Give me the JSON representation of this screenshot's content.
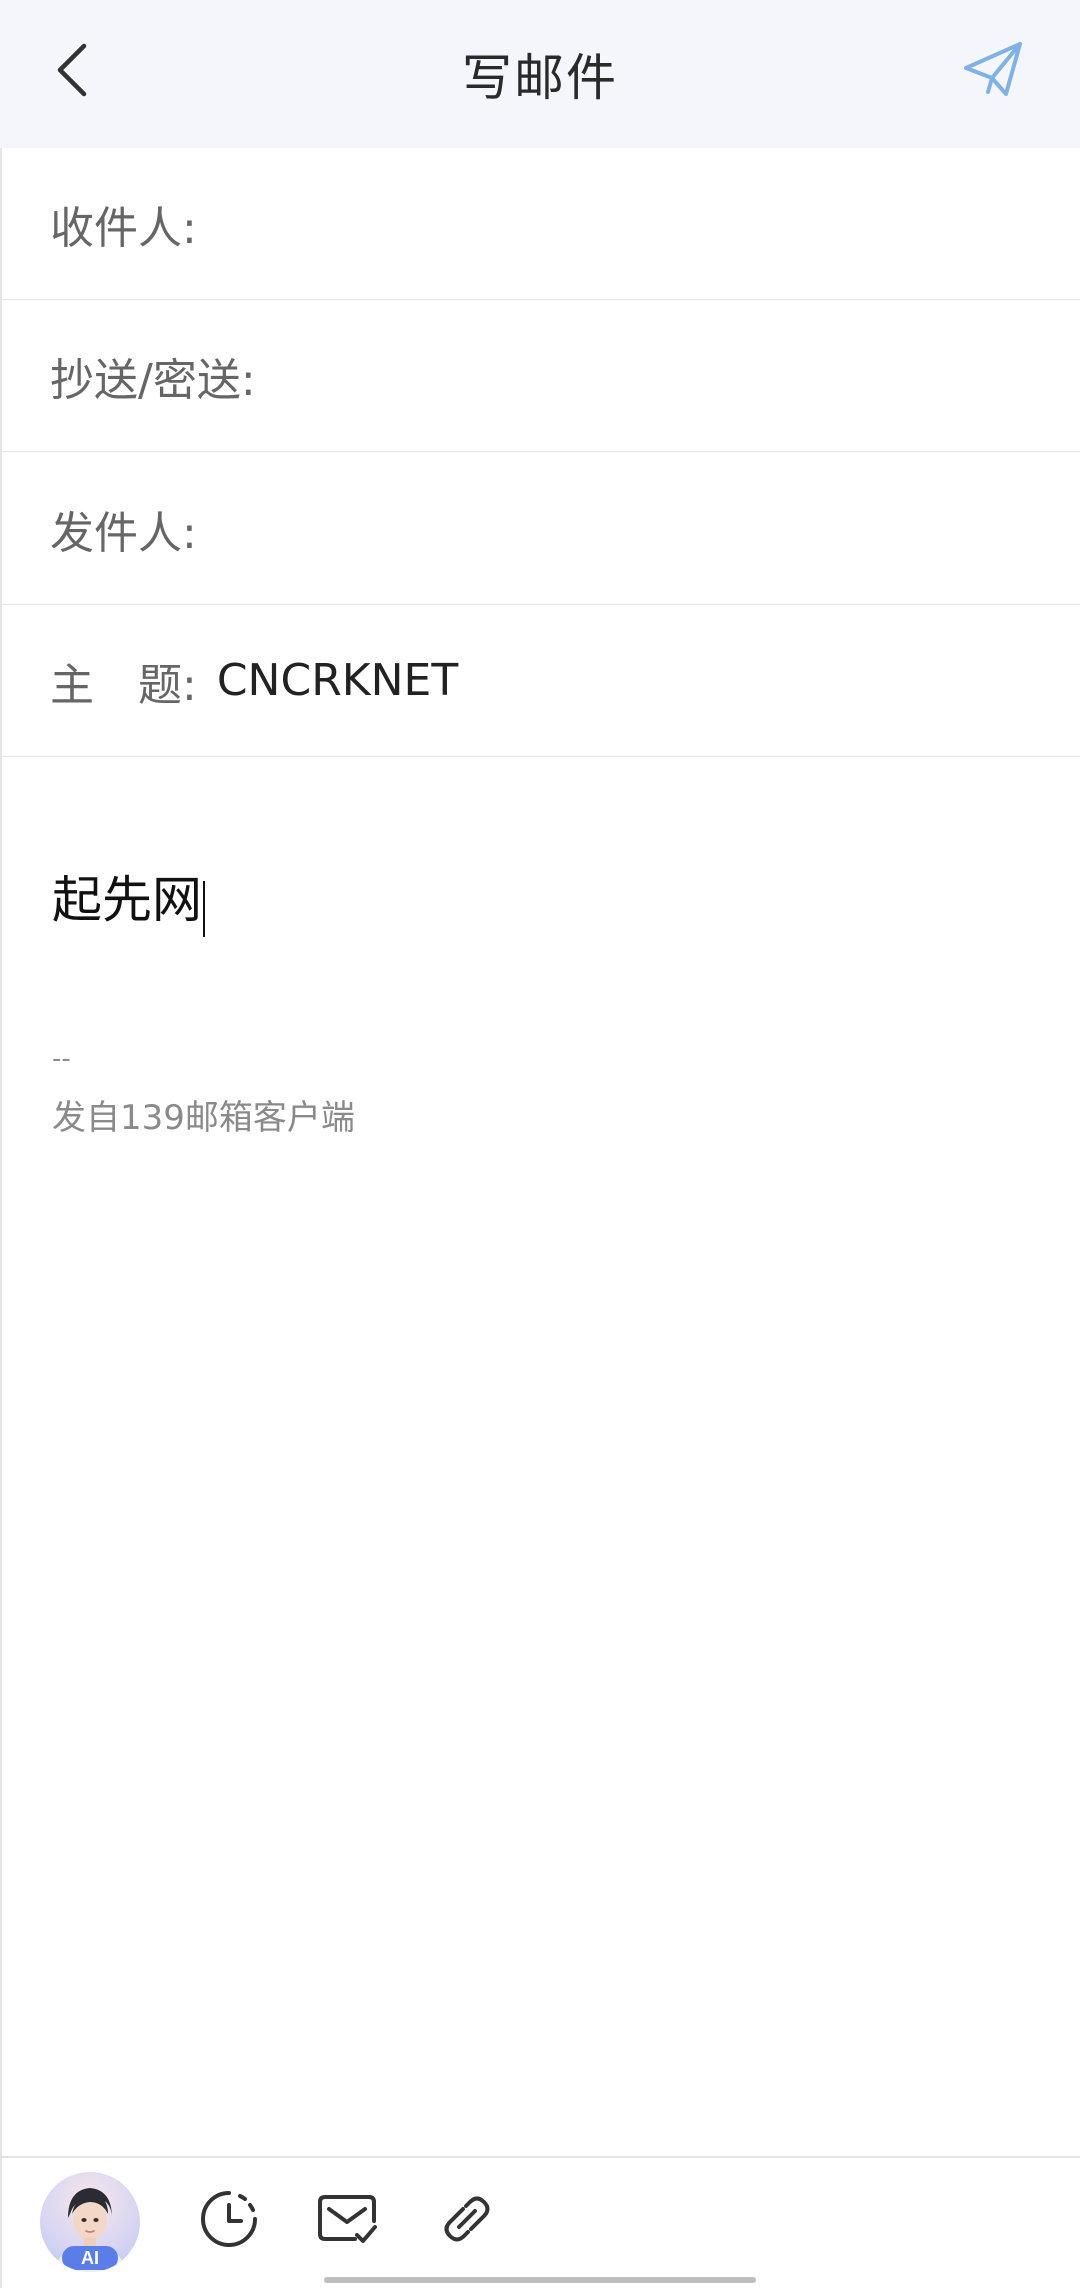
{
  "header": {
    "title": "写邮件",
    "back_icon": "chevron-left-icon",
    "send_icon": "paper-plane-icon",
    "accent_color": "#7fb3e8"
  },
  "fields": {
    "to_label": "收件人:",
    "to_value": "",
    "cc_bcc_label": "抄送/密送:",
    "cc_bcc_value": "",
    "from_label": "发件人:",
    "from_value": "",
    "subject_label": "主　题:",
    "subject_value": "CNCRKNET"
  },
  "body": {
    "text": "起先网",
    "signature_dash": "--",
    "signature": "发自139邮箱客户端"
  },
  "toolbar": {
    "ai_label": "AI",
    "items": [
      "ai-assistant-icon",
      "clock-icon",
      "envelope-check-icon",
      "paperclip-icon"
    ]
  }
}
